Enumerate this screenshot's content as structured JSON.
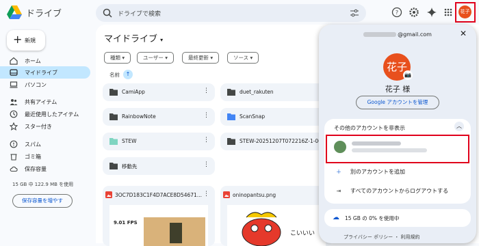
{
  "app": {
    "name": "ドライブ"
  },
  "search": {
    "placeholder": "ドライブで検索"
  },
  "header": {
    "avatar_text": "花子"
  },
  "sidebar": {
    "new_label": "新規",
    "items": [
      {
        "label": "ホーム",
        "icon": "home-icon"
      },
      {
        "label": "マイドライブ",
        "icon": "my-drive-icon",
        "active": true
      },
      {
        "label": "パソコン",
        "icon": "computer-icon"
      },
      {
        "label": "共有アイテム",
        "icon": "shared-icon"
      },
      {
        "label": "最近使用したアイテム",
        "icon": "clock-icon"
      },
      {
        "label": "スター付き",
        "icon": "star-icon"
      },
      {
        "label": "スパム",
        "icon": "spam-icon"
      },
      {
        "label": "ゴミ箱",
        "icon": "trash-icon"
      },
      {
        "label": "保存容量",
        "icon": "cloud-icon"
      }
    ],
    "storage_text": "15 GB 中 122.9 MB を使用",
    "storage_button": "保存容量を増やす"
  },
  "main": {
    "title": "マイドライブ",
    "filters": [
      "種類",
      "ユーザー",
      "最終更新",
      "ソース"
    ],
    "sort_label": "名前",
    "sort_arrow": "↑",
    "folders": [
      {
        "name": "CamiApp",
        "color": "#444746"
      },
      {
        "name": "duet_rakuten",
        "color": "#444746"
      },
      {
        "name": "RainbowNote",
        "color": "#444746"
      },
      {
        "name": "ScanSnap",
        "color": "#4285f4"
      },
      {
        "name": "STEW",
        "color": "#7fd5c1"
      },
      {
        "name": "STEW-20251207T072216Z-1-001",
        "color": "#444746"
      },
      {
        "name": "移動先",
        "color": "#444746"
      }
    ],
    "files": [
      {
        "name": "3OC7D183C1F4D7ACE8D54671...",
        "thumb_text": "9.01 FPS"
      },
      {
        "name": "oninopantsu.png",
        "thumb_text": "こいいい"
      }
    ]
  },
  "account_panel": {
    "email": "@gmail.com",
    "avatar_text": "花子",
    "greeting": "花子 様",
    "manage_button": "Google アカウントを管理",
    "accounts_toggle": "その他のアカウントを非表示",
    "add_account": "別のアカウントを追加",
    "logout_all": "すべてのアカウントからログアウトする",
    "storage": "15 GB の 0% を使用中",
    "footer": "プライバシー ポリシー ・ 利用規約"
  },
  "colors": {
    "accent": "#0b57d0",
    "avatar": "#e8501d",
    "highlight": "#e0001b",
    "active_nav": "#c2e7ff"
  }
}
